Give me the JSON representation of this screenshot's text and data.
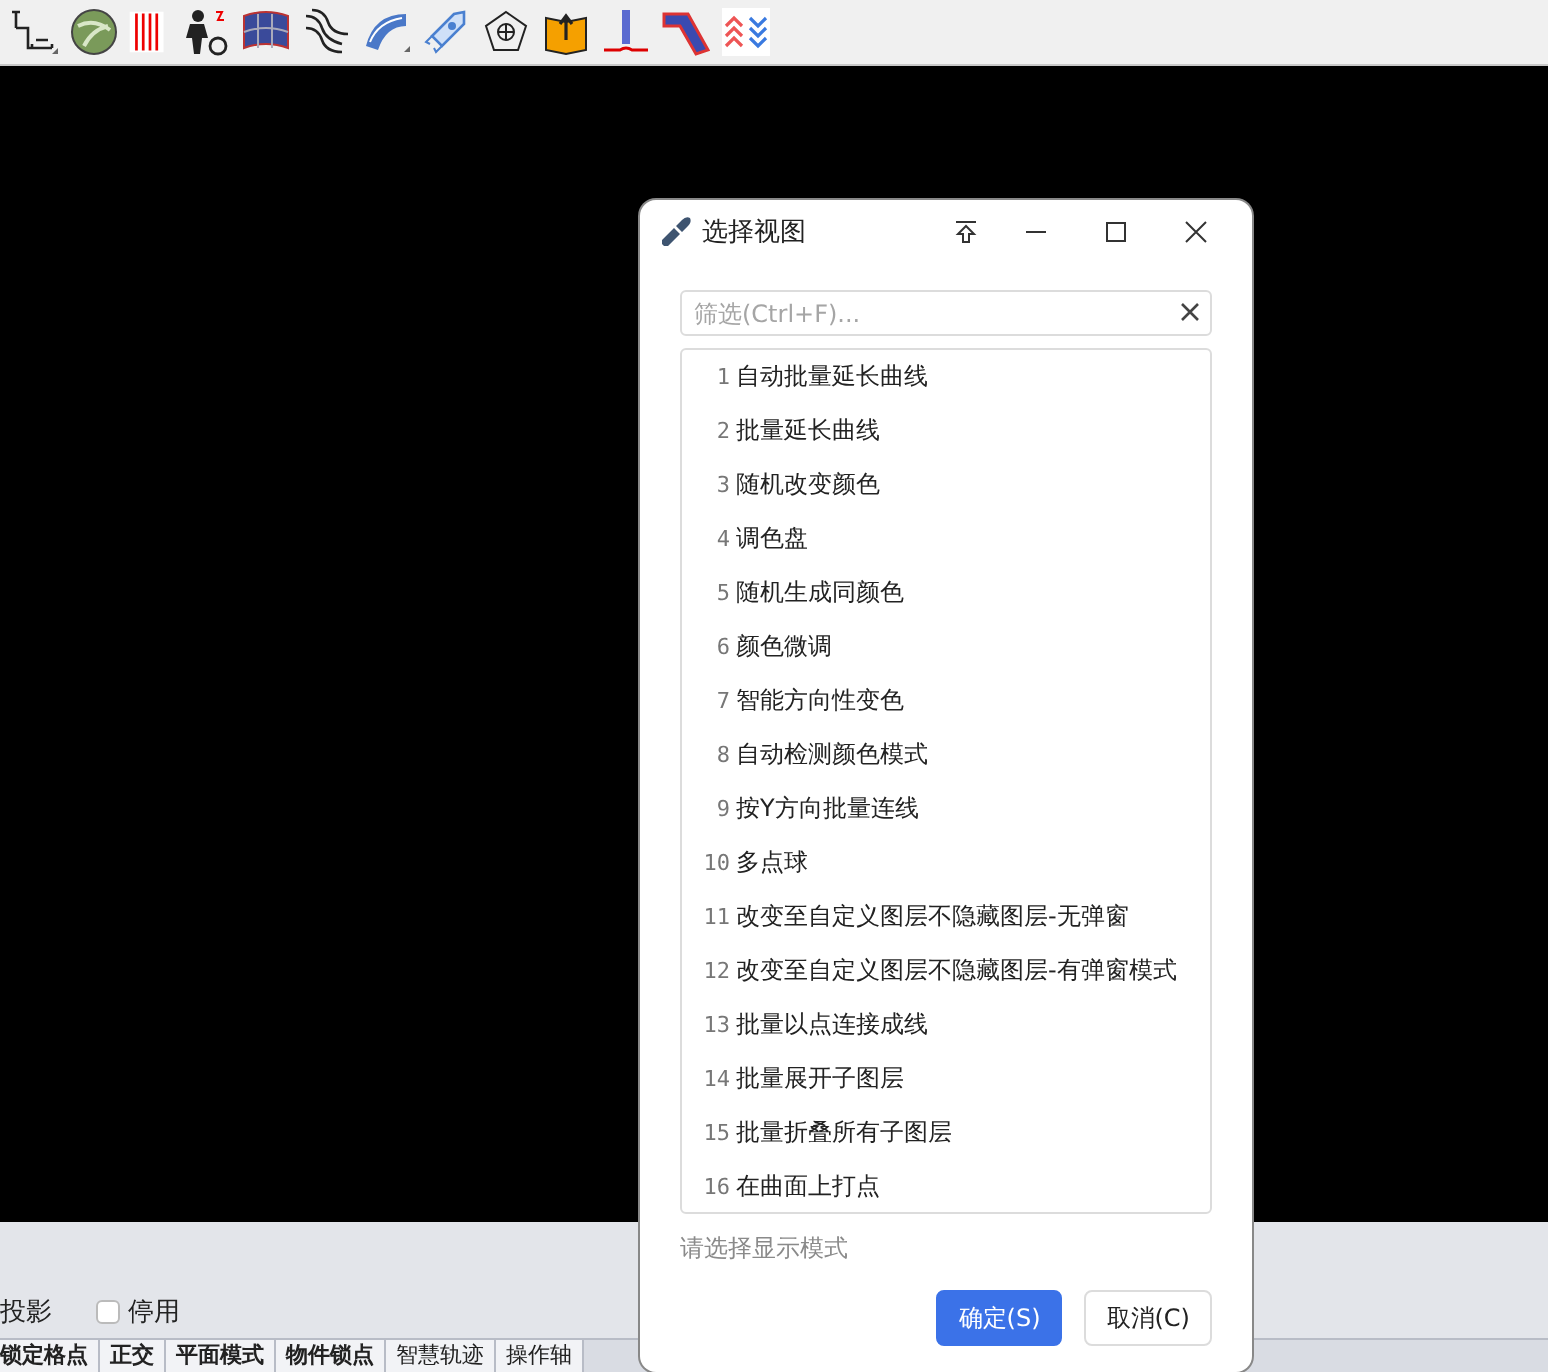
{
  "bottom_panel": {
    "projection_label": "投影",
    "disable_option": {
      "label": "停用",
      "checked": false
    }
  },
  "status_bar": [
    {
      "label": "锁定格点",
      "on": true
    },
    {
      "label": "正交",
      "on": true
    },
    {
      "label": "平面模式",
      "on": true
    },
    {
      "label": "物件锁点",
      "on": true
    },
    {
      "label": "智慧轨迹",
      "on": false
    },
    {
      "label": "操作轴",
      "on": false
    }
  ],
  "dialog": {
    "title": "选择视图",
    "filter": {
      "placeholder": "筛选(Ctrl+F)..."
    },
    "items": [
      {
        "number": "1",
        "label": "自动批量延长曲线",
        "selected": false
      },
      {
        "number": "2",
        "label": "批量延长曲线",
        "selected": false
      },
      {
        "number": "3",
        "label": "随机改变颜色",
        "selected": false
      },
      {
        "number": "4",
        "label": "调色盘",
        "selected": false
      },
      {
        "number": "5",
        "label": "随机生成同颜色",
        "selected": false
      },
      {
        "number": "6",
        "label": "颜色微调",
        "selected": false
      },
      {
        "number": "7",
        "label": "智能方向性变色",
        "selected": false
      },
      {
        "number": "8",
        "label": "自动检测颜色模式",
        "selected": false
      },
      {
        "number": "9",
        "label": "按Y方向批量连线",
        "selected": false
      },
      {
        "number": "10",
        "label": "多点球",
        "selected": false
      },
      {
        "number": "11",
        "label": "改变至自定义图层不隐藏图层-无弹窗",
        "selected": false
      },
      {
        "number": "12",
        "label": "改变至自定义图层不隐藏图层-有弹窗模式",
        "selected": false
      },
      {
        "number": "13",
        "label": "批量以点连接成线",
        "selected": false
      },
      {
        "number": "14",
        "label": "批量展开子图层",
        "selected": false
      },
      {
        "number": "15",
        "label": "批量折叠所有子图层",
        "selected": false
      },
      {
        "number": "16",
        "label": "在曲面上打点",
        "selected": false
      }
    ],
    "hint": "请选择显示模式",
    "buttons": [
      {
        "label": "确定(S)",
        "kind": "primary"
      },
      {
        "label": "取消(C)",
        "kind": "secondary"
      }
    ]
  }
}
